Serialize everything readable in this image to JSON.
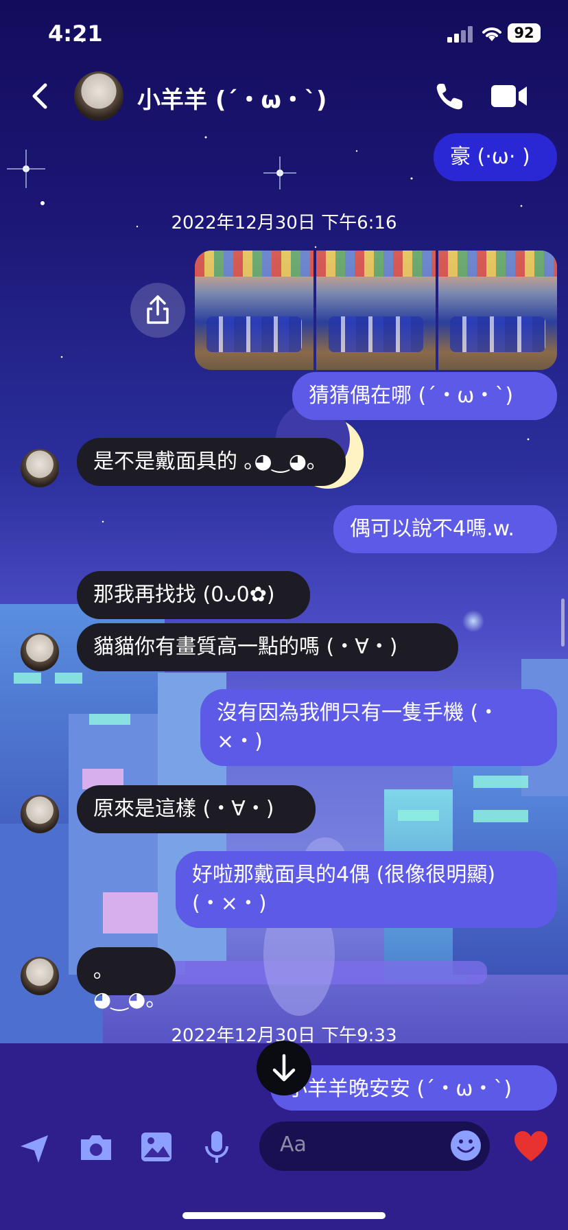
{
  "status_bar": {
    "time": "4:21",
    "battery": "92"
  },
  "header": {
    "contact_name": "小羊羊 (´・ω・`)"
  },
  "messages": [
    {
      "side": "out",
      "text": "豪 (·ω· )"
    },
    {
      "timestamp": "2022年12月30日 下午6:16"
    },
    {
      "side": "out",
      "text": "猜猜偶在哪 (´・ω・`)"
    },
    {
      "side": "in",
      "text": "是不是戴面具的 ｡◕‿◕｡"
    },
    {
      "side": "out",
      "text": "偶可以說不4嗎.w."
    },
    {
      "side": "in",
      "text": "那我再找找 (0ᴗ0✿)"
    },
    {
      "side": "in",
      "text": "貓貓你有畫質高一點的嗎 (・∀・)"
    },
    {
      "side": "out",
      "text": "沒有因為我們只有一隻手機 (・\n×・)"
    },
    {
      "side": "in",
      "text": "原來是這樣 (・∀・)"
    },
    {
      "side": "out",
      "text": "好啦那戴面具的4偶 (很像很明顯)\n(・×・)"
    },
    {
      "side": "in",
      "text": "｡◕‿◕｡"
    },
    {
      "timestamp": "2022年12月30日 下午9:33"
    },
    {
      "side": "out",
      "text": "小羊羊晚安安 (´・ω・`)"
    }
  ],
  "composer": {
    "placeholder": "Aa"
  },
  "icons": {
    "back": "chevron-left-icon",
    "call": "phone-icon",
    "video": "video-camera-icon",
    "share": "share-icon",
    "scroll_down": "arrow-down-icon",
    "location": "location-arrow-icon",
    "camera": "camera-icon",
    "gallery": "image-icon",
    "mic": "microphone-icon",
    "emoji": "emoji-icon",
    "heart": "heart-icon"
  },
  "colors": {
    "outgoing": "#5e5ae8",
    "outgoing_dark": "#2a27d4",
    "incoming": "#1d1b24",
    "heart": "#e8322f"
  }
}
